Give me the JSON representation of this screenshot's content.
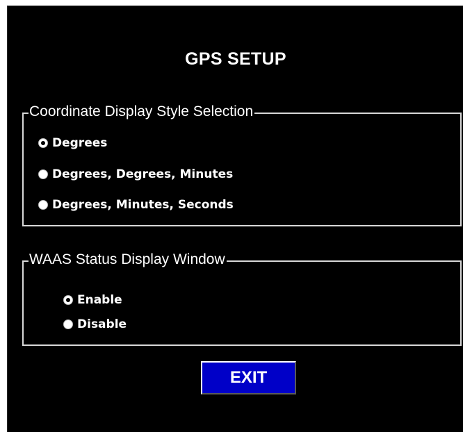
{
  "window": {
    "title": "GPS SETUP"
  },
  "coordinate_group": {
    "legend": "Coordinate Display Style Selection",
    "selected": "Degrees",
    "options": [
      {
        "label": "Degrees",
        "selected": true
      },
      {
        "label": "Degrees, Degrees, Minutes",
        "selected": false
      },
      {
        "label": "Degrees, Minutes, Seconds",
        "selected": false
      }
    ]
  },
  "waas_group": {
    "legend": "WAAS Status Display Window",
    "selected": "Enable",
    "options": [
      {
        "label": "Enable",
        "selected": true
      },
      {
        "label": "Disable",
        "selected": false
      }
    ]
  },
  "buttons": {
    "exit_label": "EXIT"
  },
  "colors": {
    "background": "#000000",
    "text": "#ffffff",
    "border": "#d8d8d8",
    "button": "#0000c8"
  }
}
